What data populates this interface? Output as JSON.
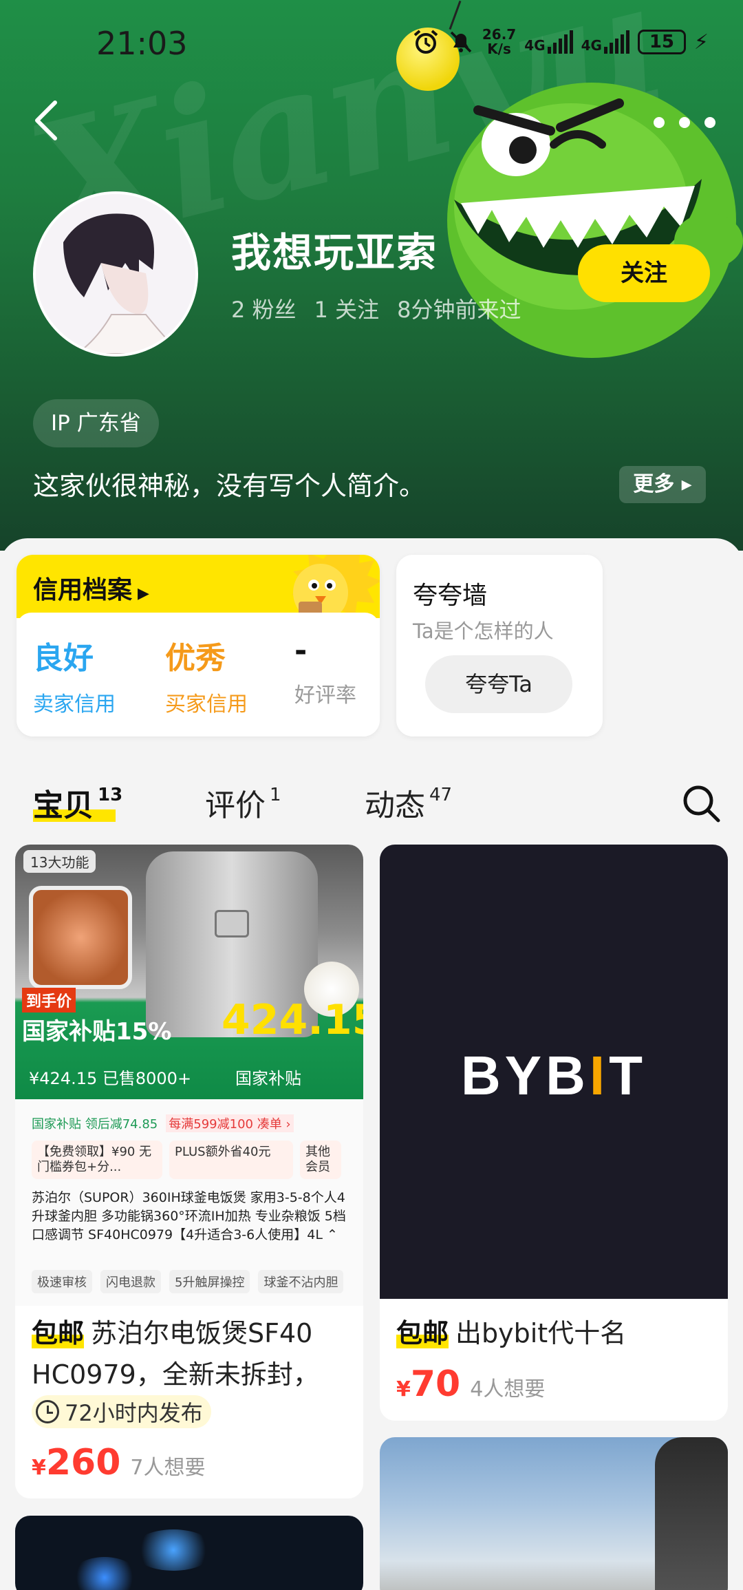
{
  "status": {
    "time": "21:03",
    "net_speed_top": "26.7",
    "net_speed_bottom": "K/s",
    "sig1": "4G",
    "sig2": "4G",
    "battery": "15"
  },
  "header": {
    "watermark": "Xianyu"
  },
  "profile": {
    "name": "我想玩亚索",
    "fans": "2 粉丝",
    "following": "1 关注",
    "last_seen": "8分钟前来过",
    "follow_label": "关注",
    "ip": "IP 广东省",
    "bio": "这家伙很神秘，没有写个人简介。",
    "more_label": "更多"
  },
  "credit": {
    "title": "信用档案",
    "seller_value": "良好",
    "seller_label": "卖家信用",
    "buyer_value": "优秀",
    "buyer_label": "买家信用",
    "rate_value": "-",
    "rate_label": "好评率",
    "seller_color": "#2aa6f0",
    "buyer_color": "#f59a1a"
  },
  "kuakua": {
    "title": "夸夸墙",
    "subtitle": "Ta是个怎样的人",
    "button": "夸夸Ta"
  },
  "tabs": [
    {
      "label": "宝贝",
      "count": "13"
    },
    {
      "label": "评价",
      "count": "1"
    },
    {
      "label": "动态",
      "count": "47"
    }
  ],
  "products": [
    {
      "badge": "包邮",
      "title_line1": "苏泊尔电饭煲SF40",
      "title_line2": "HC0979，全新未拆封，",
      "time_tag": "72小时内发布",
      "currency": "¥",
      "price": "260",
      "want": "7人想要",
      "image": {
        "chip": "13大功能",
        "promo_tag": "到手价",
        "promo_main": "国家补贴15%",
        "promo_price": "424.15",
        "promo_left": "¥424.15 已售8000+",
        "promo_right": "国家补贴",
        "row1_a": "国家补贴 领后减74.85",
        "row1_b": "每满599减100 凑单 ›",
        "coupon_a": "【免费领取】¥90 无门槛券包+分...",
        "coupon_b": "PLUS额外省40元",
        "coupon_c": "其他会员",
        "desc": "苏泊尔（SUPOR）360IH球釜电饭煲 家用3-5-8个人4升球釜内胆 多功能锅360°环流IH加热 专业杂粮饭 5档口感调节 SF40HC0979【4升适合3-6人使用】4L ⌃",
        "tag1": "极速审核",
        "tag2": "闪电退款",
        "tag3": "5升触屏操控",
        "tag4": "球釜不沾内胆"
      }
    },
    {
      "badge": "包邮",
      "title_line1": "出bybit代十名",
      "currency": "¥",
      "price": "70",
      "want": "4人想要",
      "image": {
        "logo_left": "BYB",
        "logo_bar": "I",
        "logo_right": "T"
      }
    }
  ],
  "icons": [
    "back-icon",
    "more-icon",
    "search-icon",
    "clock-icon",
    "alarm-icon",
    "mute-icon",
    "bolt-icon"
  ]
}
